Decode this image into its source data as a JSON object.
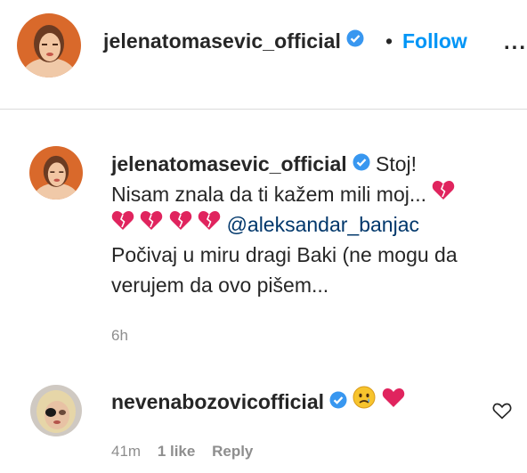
{
  "post_header": {
    "username": "jelenatomasevic_official",
    "separator": "•",
    "follow_label": "Follow",
    "more_label": "..."
  },
  "comments": [
    {
      "username": "jelenatomasevic_official",
      "text_line1": "Stoj!",
      "text_line2": "Nisam znala da ti kažem mili moj...",
      "mention": "@aleksandar_banjac",
      "text_line4": "Počivaj u miru dragi Baki (ne mogu da",
      "text_line5": "verujem da ovo pišem...",
      "time": "6h"
    },
    {
      "username": "nevenabozovicofficial",
      "time": "41m",
      "likes": "1 like",
      "reply_label": "Reply"
    }
  ],
  "colors": {
    "follow": "#0095f6",
    "verified": "#3897f0",
    "heart": "#e0245e",
    "mention": "#00376b",
    "muted": "#8e8e8e"
  }
}
